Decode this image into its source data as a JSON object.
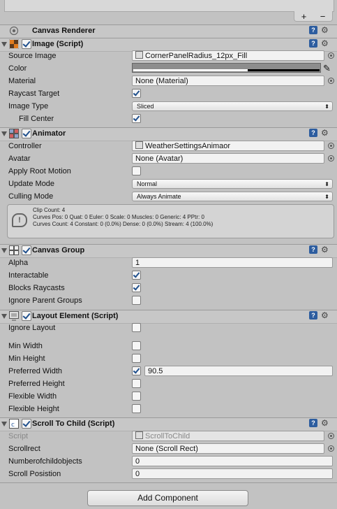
{
  "top": {
    "plus": "+",
    "minus": "−"
  },
  "canvas_renderer": {
    "title": "Canvas Renderer"
  },
  "image": {
    "title": "Image (Script)",
    "source_image_label": "Source Image",
    "source_image_value": "CornerPanelRadius_12px_Fill",
    "color_label": "Color",
    "material_label": "Material",
    "material_value": "None (Material)",
    "raycast_label": "Raycast Target",
    "raycast_checked": true,
    "image_type_label": "Image Type",
    "image_type_value": "Sliced",
    "fill_center_label": "Fill Center",
    "fill_center_checked": true
  },
  "animator": {
    "title": "Animator",
    "controller_label": "Controller",
    "controller_value": "WeatherSettingsAnimaor",
    "avatar_label": "Avatar",
    "avatar_value": "None (Avatar)",
    "apply_root_label": "Apply Root Motion",
    "update_mode_label": "Update Mode",
    "update_mode_value": "Normal",
    "culling_mode_label": "Culling Mode",
    "culling_mode_value": "Always Animate",
    "info_line1": "Clip Count: 4",
    "info_line2": "Curves Pos: 0 Quat: 0 Euler: 0 Scale: 0 Muscles: 0 Generic: 4 PPtr: 0",
    "info_line3": "Curves Count: 4 Constant: 0 (0.0%) Dense: 0 (0.0%) Stream: 4 (100.0%)"
  },
  "canvas_group": {
    "title": "Canvas Group",
    "alpha_label": "Alpha",
    "alpha_value": "1",
    "interactable_label": "Interactable",
    "blocks_label": "Blocks Raycasts",
    "ignore_parent_label": "Ignore Parent Groups"
  },
  "layout_element": {
    "title": "Layout Element (Script)",
    "ignore_layout_label": "Ignore Layout",
    "min_width_label": "Min Width",
    "min_height_label": "Min Height",
    "pref_width_label": "Preferred Width",
    "pref_width_value": "90.5",
    "pref_height_label": "Preferred Height",
    "flex_width_label": "Flexible Width",
    "flex_height_label": "Flexible Height"
  },
  "scroll_to_child": {
    "title": "Scroll To Child (Script)",
    "script_label": "Script",
    "script_value": "ScrollToChild",
    "scrollrect_label": "Scrollrect",
    "scrollrect_value": "None (Scroll Rect)",
    "numchild_label": "Numberofchildobjects",
    "numchild_value": "0",
    "scrollpos_label": "Scroll Posistion",
    "scrollpos_value": "0"
  },
  "add_component_label": "Add Component",
  "colors": {
    "panel_bg": "#c2c2c2",
    "checkmark": "#1f4f8c",
    "book_icon": "#2d5d9f"
  }
}
